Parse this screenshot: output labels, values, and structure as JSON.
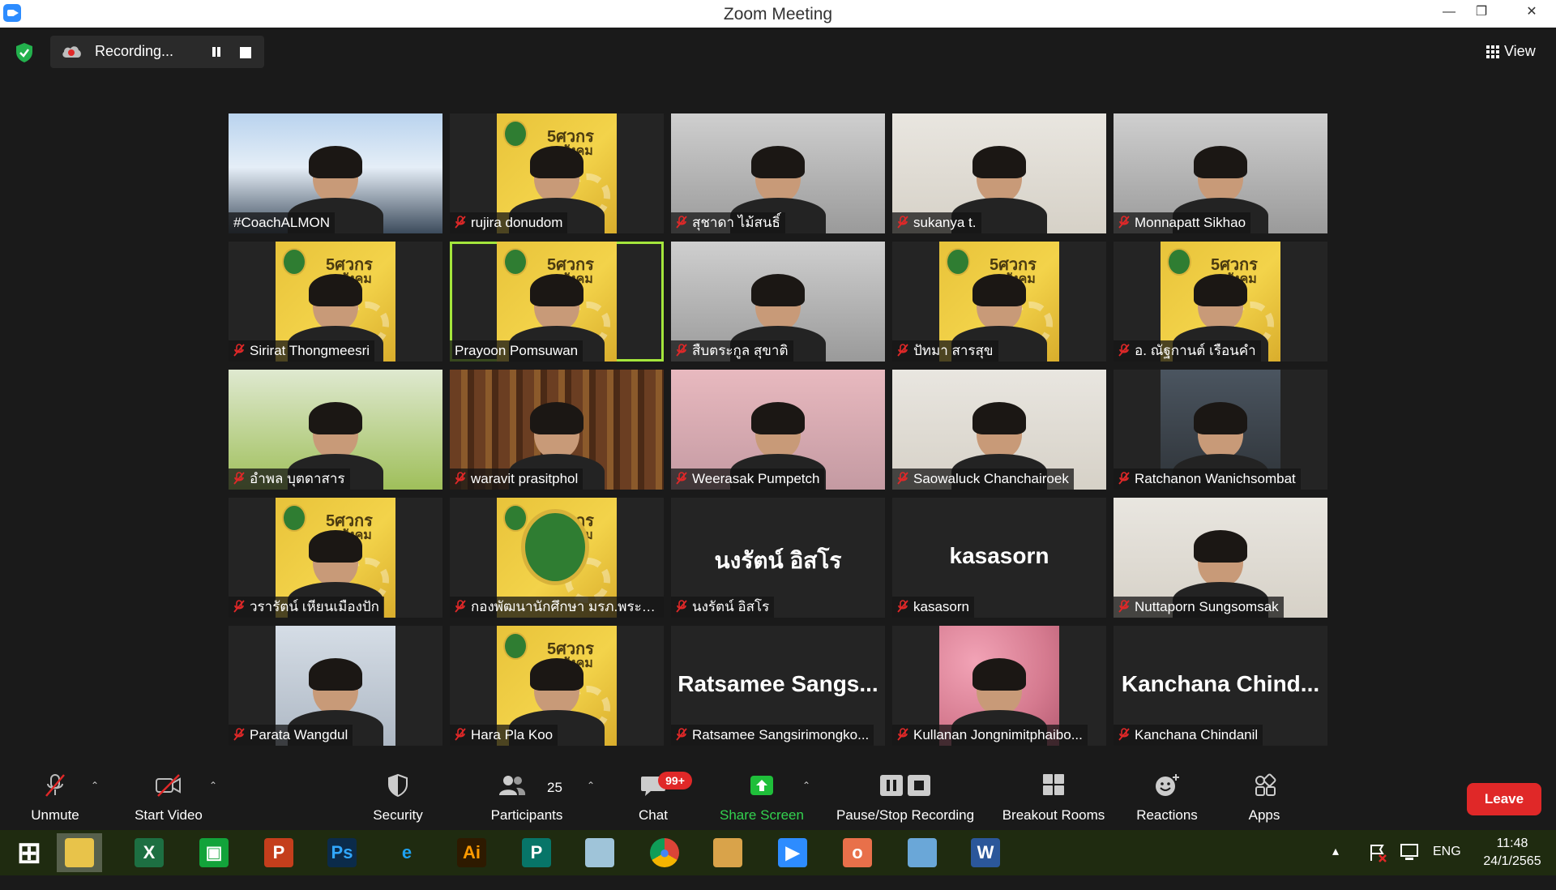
{
  "window": {
    "title": "Zoom Meeting",
    "minimize_icon": "minimize-icon",
    "restore_icon": "restore-icon",
    "close_icon": "close-icon"
  },
  "topbar": {
    "recording_label": "Recording...",
    "view_label": "View"
  },
  "participants": [
    {
      "name": "#CoachALMON",
      "muted": false,
      "video": "coach"
    },
    {
      "name": "rujira donudom",
      "muted": true,
      "video": "yellow-person"
    },
    {
      "name": "สุชาดา ไม้สนธิ์",
      "muted": true,
      "video": "gray-person"
    },
    {
      "name": "sukanya t.",
      "muted": true,
      "video": "room-person"
    },
    {
      "name": "Monnapatt Sikhao",
      "muted": true,
      "video": "gray-person"
    },
    {
      "name": "Sirirat Thongmeesri",
      "muted": true,
      "video": "yellow-person"
    },
    {
      "name": "Prayoon Pomsuwan",
      "muted": false,
      "video": "yellow-person",
      "active": true
    },
    {
      "name": "สืบตระกูล สุขาติ",
      "muted": true,
      "video": "gray-person"
    },
    {
      "name": "ปัทมา สารสุข",
      "muted": true,
      "video": "yellow-person"
    },
    {
      "name": "อ. ณัฐกานต์ เรือนคำ",
      "muted": true,
      "video": "yellow-person"
    },
    {
      "name": "อำพล บุตดาสาร",
      "muted": true,
      "video": "green-person"
    },
    {
      "name": "waravit prasitphol",
      "muted": true,
      "video": "library-person"
    },
    {
      "name": "Weerasak Pumpetch",
      "muted": true,
      "video": "pink-person"
    },
    {
      "name": "Saowaluck Chanchairoek",
      "muted": true,
      "video": "room-person"
    },
    {
      "name": "Ratchanon Wanichsombat",
      "muted": true,
      "video": "cafe-person"
    },
    {
      "name": "วรารัตน์ เหียนเมืองปัก",
      "muted": true,
      "video": "yellow-person"
    },
    {
      "name": "กองพัฒนานักศึกษา มรภ.พระนคร",
      "muted": true,
      "video": "yellow-logo"
    },
    {
      "name": "นงรัตน์ อิสโร",
      "muted": true,
      "video": "none",
      "big_name": "นงรัตน์ อิสโร"
    },
    {
      "name": "kasasorn",
      "muted": true,
      "video": "none",
      "big_name": "kasasorn"
    },
    {
      "name": "Nuttaporn Sungsomsak",
      "muted": true,
      "video": "room-person"
    },
    {
      "name": "Parata Wangdul",
      "muted": true,
      "video": "office-person"
    },
    {
      "name": "Hara Pla Koo",
      "muted": true,
      "video": "yellow-person"
    },
    {
      "name": "Ratsamee Sangsirimongko...",
      "muted": true,
      "video": "none",
      "big_name": "Ratsamee Sangs..."
    },
    {
      "name": "Kullanan Jongnimitphaibo...",
      "muted": true,
      "video": "flowers-person"
    },
    {
      "name": "Kanchana Chindanil",
      "muted": true,
      "video": "none",
      "big_name": "Kanchana Chind..."
    }
  ],
  "tile_logo_text": {
    "sawat": "5ศวกร",
    "sangkhom": "สังคม"
  },
  "toolbar": {
    "unmute": "Unmute",
    "start_video": "Start Video",
    "security": "Security",
    "participants": "Participants",
    "participants_count": "25",
    "chat": "Chat",
    "chat_badge": "99+",
    "share_screen": "Share Screen",
    "pause_stop": "Pause/Stop Recording",
    "breakout": "Breakout Rooms",
    "reactions": "Reactions",
    "apps": "Apps",
    "leave": "Leave"
  },
  "taskbar": {
    "apps": [
      "windows-start",
      "file-explorer",
      "excel",
      "publisher-green",
      "powerpoint",
      "photoshop",
      "internet-explorer",
      "illustrator",
      "publisher",
      "notepad",
      "chrome",
      "paint",
      "zoom",
      "powerpoint-orange",
      "control-panel",
      "word"
    ],
    "lang": "ENG",
    "time": "11:48",
    "date": "24/1/2565"
  },
  "colors": {
    "accent_green": "#a4e63c",
    "leave_red": "#e02828",
    "share_green": "#1fbf3a",
    "zoom_blue": "#2d8cff"
  }
}
